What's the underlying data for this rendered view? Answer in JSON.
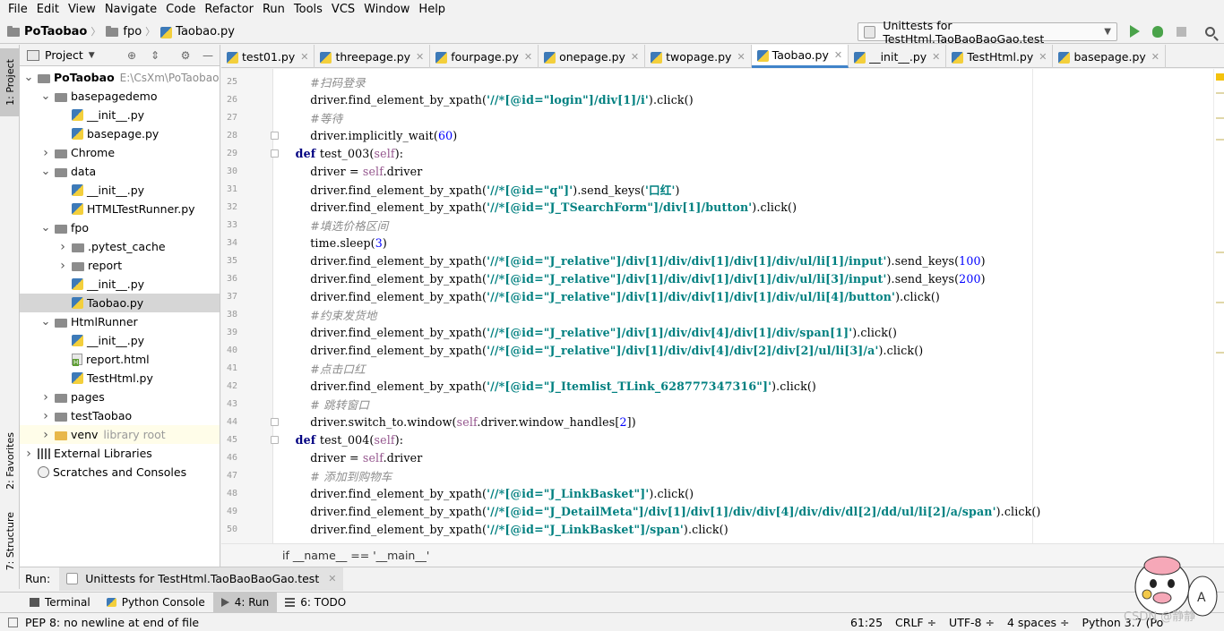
{
  "menu": [
    "File",
    "Edit",
    "View",
    "Navigate",
    "Code",
    "Refactor",
    "Run",
    "Tools",
    "VCS",
    "Window",
    "Help"
  ],
  "breadcrumb": {
    "project": "PoTaobao",
    "folder": "fpo",
    "file": "Taobao.py"
  },
  "run_config": {
    "label": "Unittests for TestHtml.TaoBaoBaoGao.test"
  },
  "left_strip": {
    "project": "1: Project",
    "favorites": "2: Favorites",
    "structure": "7: Structure"
  },
  "project_panel": {
    "title": "Project",
    "tree": [
      {
        "label": "PoTaobao",
        "extra": "E:\\CsXm\\PoTaobao",
        "type": "root",
        "depth": 0,
        "expanded": true
      },
      {
        "label": "basepagedemo",
        "type": "folder",
        "depth": 1,
        "expanded": true
      },
      {
        "label": "__init__.py",
        "type": "py",
        "depth": 2
      },
      {
        "label": "basepage.py",
        "type": "py",
        "depth": 2
      },
      {
        "label": "Chrome",
        "type": "folder",
        "depth": 1,
        "expanded": false
      },
      {
        "label": "data",
        "type": "folder",
        "depth": 1,
        "expanded": true
      },
      {
        "label": "__init__.py",
        "type": "py",
        "depth": 2
      },
      {
        "label": "HTMLTestRunner.py",
        "type": "py",
        "depth": 2
      },
      {
        "label": "fpo",
        "type": "folder",
        "depth": 1,
        "expanded": true
      },
      {
        "label": ".pytest_cache",
        "type": "folder",
        "depth": 2,
        "expanded": false
      },
      {
        "label": "report",
        "type": "folder",
        "depth": 2,
        "expanded": false
      },
      {
        "label": "__init__.py",
        "type": "py",
        "depth": 2
      },
      {
        "label": "Taobao.py",
        "type": "py",
        "depth": 2,
        "selected": true
      },
      {
        "label": "HtmlRunner",
        "type": "folder",
        "depth": 1,
        "expanded": true
      },
      {
        "label": "__init__.py",
        "type": "py",
        "depth": 2
      },
      {
        "label": "report.html",
        "type": "html",
        "depth": 2
      },
      {
        "label": "TestHtml.py",
        "type": "py",
        "depth": 2
      },
      {
        "label": "pages",
        "type": "folder",
        "depth": 1,
        "expanded": false
      },
      {
        "label": "testTaobao",
        "type": "folder",
        "depth": 1,
        "expanded": false
      },
      {
        "label": "venv",
        "extra": "library root",
        "type": "lib",
        "depth": 1,
        "expanded": false
      },
      {
        "label": "External Libraries",
        "type": "bars",
        "depth": 0,
        "expanded": false
      },
      {
        "label": "Scratches and Consoles",
        "type": "scratch",
        "depth": 0
      }
    ]
  },
  "tabs": [
    {
      "label": "test01.py"
    },
    {
      "label": "threepage.py"
    },
    {
      "label": "fourpage.py"
    },
    {
      "label": "onepage.py"
    },
    {
      "label": "twopage.py"
    },
    {
      "label": "Taobao.py",
      "active": true
    },
    {
      "label": "__init__.py"
    },
    {
      "label": "TestHtml.py"
    },
    {
      "label": "basepage.py"
    }
  ],
  "code": [
    {
      "n": "25",
      "tokens": [
        [
          "        ",
          ""
        ],
        [
          "#扫码登录",
          "cmt"
        ]
      ]
    },
    {
      "n": "26",
      "tokens": [
        [
          "        driver.find_element_by_xpath(",
          ""
        ],
        [
          "'//*[@id=\"login\"]/div[1]/i'",
          "str"
        ],
        [
          ").click()",
          ""
        ]
      ]
    },
    {
      "n": "27",
      "tokens": [
        [
          "        ",
          ""
        ],
        [
          "#等待",
          "cmt"
        ]
      ]
    },
    {
      "n": "28",
      "fold": true,
      "tokens": [
        [
          "        driver.implicitly_wait(",
          ""
        ],
        [
          "60",
          "num"
        ],
        [
          ")",
          ""
        ]
      ]
    },
    {
      "n": "29",
      "fold": true,
      "tokens": [
        [
          "    ",
          ""
        ],
        [
          "def ",
          "kw"
        ],
        [
          "test_003(",
          ""
        ],
        [
          "self",
          "self"
        ],
        [
          "):",
          ""
        ]
      ]
    },
    {
      "n": "30",
      "tokens": [
        [
          "        driver = ",
          ""
        ],
        [
          "self",
          "self"
        ],
        [
          ".driver",
          ""
        ]
      ]
    },
    {
      "n": "31",
      "tokens": [
        [
          "        driver.find_element_by_xpath(",
          ""
        ],
        [
          "'//*[@id=\"q\"]'",
          "str"
        ],
        [
          ").send_keys(",
          ""
        ],
        [
          "'口红'",
          "str"
        ],
        [
          ")",
          ""
        ]
      ]
    },
    {
      "n": "32",
      "tokens": [
        [
          "        driver.find_element_by_xpath(",
          ""
        ],
        [
          "'//*[@id=\"J_TSearchForm\"]/div[1]/button'",
          "str"
        ],
        [
          ").click()",
          ""
        ]
      ]
    },
    {
      "n": "33",
      "tokens": [
        [
          "        ",
          ""
        ],
        [
          "#填选价格区间",
          "cmt"
        ]
      ]
    },
    {
      "n": "34",
      "tokens": [
        [
          "        time.sleep(",
          ""
        ],
        [
          "3",
          "num"
        ],
        [
          ")",
          ""
        ]
      ]
    },
    {
      "n": "35",
      "tokens": [
        [
          "        driver.find_element_by_xpath(",
          ""
        ],
        [
          "'//*[@id=\"J_relative\"]/div[1]/div/div[1]/div[1]/div/ul/li[1]/input'",
          "str"
        ],
        [
          ").send_keys(",
          ""
        ],
        [
          "100",
          "num"
        ],
        [
          ")",
          ""
        ]
      ]
    },
    {
      "n": "36",
      "tokens": [
        [
          "        driver.find_element_by_xpath(",
          ""
        ],
        [
          "'//*[@id=\"J_relative\"]/div[1]/div/div[1]/div[1]/div/ul/li[3]/input'",
          "str"
        ],
        [
          ").send_keys(",
          ""
        ],
        [
          "200",
          "num"
        ],
        [
          ")",
          ""
        ]
      ]
    },
    {
      "n": "37",
      "tokens": [
        [
          "        driver.find_element_by_xpath(",
          ""
        ],
        [
          "'//*[@id=\"J_relative\"]/div[1]/div/div[1]/div[1]/div/ul/li[4]/button'",
          "str"
        ],
        [
          ").click()",
          ""
        ]
      ]
    },
    {
      "n": "38",
      "tokens": [
        [
          "        ",
          ""
        ],
        [
          "#约束发货地",
          "cmt"
        ]
      ]
    },
    {
      "n": "39",
      "tokens": [
        [
          "        driver.find_element_by_xpath(",
          ""
        ],
        [
          "'//*[@id=\"J_relative\"]/div[1]/div/div[4]/div[1]/div/span[1]'",
          "str"
        ],
        [
          ").click()",
          ""
        ]
      ]
    },
    {
      "n": "40",
      "tokens": [
        [
          "        driver.find_element_by_xpath(",
          ""
        ],
        [
          "'//*[@id=\"J_relative\"]/div[1]/div/div[4]/div[2]/div[2]/ul/li[3]/a'",
          "str"
        ],
        [
          ").click()",
          ""
        ]
      ]
    },
    {
      "n": "41",
      "tokens": [
        [
          "        ",
          ""
        ],
        [
          "#点击口红",
          "cmt"
        ]
      ]
    },
    {
      "n": "42",
      "tokens": [
        [
          "        driver.find_element_by_xpath(",
          ""
        ],
        [
          "'//*[@id=\"J_Itemlist_TLink_628777347316\"]'",
          "str"
        ],
        [
          ").click()",
          ""
        ]
      ]
    },
    {
      "n": "43",
      "tokens": [
        [
          "        ",
          ""
        ],
        [
          "# 跳转窗口",
          "cmt"
        ]
      ]
    },
    {
      "n": "44",
      "fold": true,
      "tokens": [
        [
          "        driver.switch_to.window(",
          ""
        ],
        [
          "self",
          "self"
        ],
        [
          ".driver.window_handles[",
          ""
        ],
        [
          "2",
          "num"
        ],
        [
          "])",
          ""
        ]
      ]
    },
    {
      "n": "45",
      "fold": true,
      "tokens": [
        [
          "    ",
          ""
        ],
        [
          "def ",
          "kw"
        ],
        [
          "test_004(",
          ""
        ],
        [
          "self",
          "self"
        ],
        [
          "):",
          ""
        ]
      ]
    },
    {
      "n": "46",
      "tokens": [
        [
          "        driver = ",
          ""
        ],
        [
          "self",
          "self"
        ],
        [
          ".driver",
          ""
        ]
      ]
    },
    {
      "n": "47",
      "tokens": [
        [
          "        ",
          ""
        ],
        [
          "# 添加到购物车",
          "cmt"
        ]
      ]
    },
    {
      "n": "48",
      "tokens": [
        [
          "        driver.find_element_by_xpath(",
          ""
        ],
        [
          "'//*[@id=\"J_LinkBasket\"]'",
          "str"
        ],
        [
          ").click()",
          ""
        ]
      ]
    },
    {
      "n": "49",
      "tokens": [
        [
          "        driver.find_element_by_xpath(",
          ""
        ],
        [
          "'//*[@id=\"J_DetailMeta\"]/div[1]/div[1]/div/div[4]/div/div/dl[2]/dd/ul/li[2]/a/span'",
          "str"
        ],
        [
          ").click()",
          ""
        ]
      ]
    },
    {
      "n": "50",
      "tokens": [
        [
          "        driver.find_element_by_xpath(",
          ""
        ],
        [
          "'//*[@id=\"J_LinkBasket\"]/span'",
          "str"
        ],
        [
          ").click()",
          ""
        ]
      ]
    }
  ],
  "editor_breadcrumb": "if __name__ == '__main__'",
  "run_panel": {
    "label": "Run:",
    "tab": "Unittests for TestHtml.TaoBaoBaoGao.test"
  },
  "tool_windows": [
    {
      "label": "Terminal",
      "icon": "terminal"
    },
    {
      "label": "Python Console",
      "icon": "python"
    },
    {
      "label": "4: Run",
      "icon": "run",
      "active": true
    },
    {
      "label": "6: TODO",
      "icon": "todo"
    }
  ],
  "status": {
    "message": "PEP 8: no newline at end of file",
    "position": "61:25",
    "line_sep": "CRLF ÷",
    "encoding": "UTF-8 ÷",
    "indent": "4 spaces ÷",
    "interpreter": "Python 3.7 (Po"
  },
  "watermark": "CSDN @静静"
}
